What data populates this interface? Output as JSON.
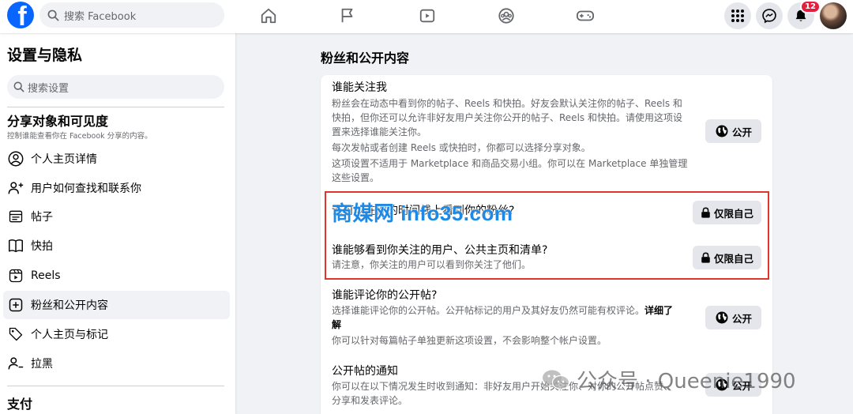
{
  "topbar": {
    "logo": "f",
    "search_placeholder": "搜索 Facebook",
    "notification_count": "12",
    "nav_icons": [
      "home-icon",
      "flag-icon",
      "video-icon",
      "groups-icon",
      "gaming-icon"
    ],
    "right_icons": [
      "menu-grid-icon",
      "messenger-icon",
      "bell-icon"
    ]
  },
  "sidebar": {
    "title": "设置与隐私",
    "search_placeholder": "搜索设置",
    "section1_title": "分享对象和可见度",
    "section1_sub": "控制谁能查看你在 Facebook 分享的内容。",
    "items": [
      {
        "label": "个人主页详情",
        "icon": "user-circle-icon"
      },
      {
        "label": "用户如何查找和联系你",
        "icon": "user-add-icon"
      },
      {
        "label": "帖子",
        "icon": "post-icon"
      },
      {
        "label": "快拍",
        "icon": "book-icon"
      },
      {
        "label": "Reels",
        "icon": "reels-icon"
      },
      {
        "label": "粉丝和公开内容",
        "icon": "plus-square-icon"
      },
      {
        "label": "个人主页与标记",
        "icon": "tag-icon"
      },
      {
        "label": "拉黑",
        "icon": "block-user-icon"
      }
    ],
    "section2_title": "支付"
  },
  "main": {
    "heading": "粉丝和公开内容",
    "sections": [
      {
        "title": "谁能关注我",
        "desc": [
          "粉丝会在动态中看到你的帖子、Reels 和快拍。好友会默认关注你的帖子、Reels 和",
          "快拍，但你还可以允许非好友用户关注你公开的帖子、Reels 和快拍。请使用这项设",
          "置来选择谁能关注你。",
          "每次发帖或者创建 Reels 或快拍时，你都可以选择分享对象。",
          "这项设置不适用于 Marketplace 和商品交易小组。你可以在 Marketplace 单独管理",
          "这些设置。"
        ],
        "button": "公开"
      },
      {
        "title": "谁可以在你的时间线上看到你的粉丝?",
        "button": "仅限自己"
      },
      {
        "title": "谁能够看到你关注的用户、公共主页和清单?",
        "desc": [
          "请注意，你关注的用户可以看到你关注了他们。"
        ],
        "button": "仅限自己"
      },
      {
        "title": "谁能评论你的公开帖?",
        "desc_a": "选择谁能评论你的公开帖。公开帖标记的用户及其好友仍然可能有权评论。",
        "desc_link": "详细了",
        "desc_link2": "解",
        "desc_b": "你可以针对每篇帖子单独更新这项设置，不会影响整个帐户设置。",
        "button": "公开"
      },
      {
        "title": "公开帖的通知",
        "desc": [
          "你可以在以下情况发生时收到通知：非好友用户开始关注你、对你的公开帖点赞、",
          "分享和发表评论。"
        ],
        "button": "公开"
      }
    ]
  },
  "watermarks": {
    "site": "商媒网 info35.com",
    "wechat": "公众号 · Queenie1990"
  },
  "colors": {
    "brand": "#0866ff",
    "highlight": "#e0352b",
    "badge": "#e41e3f"
  }
}
